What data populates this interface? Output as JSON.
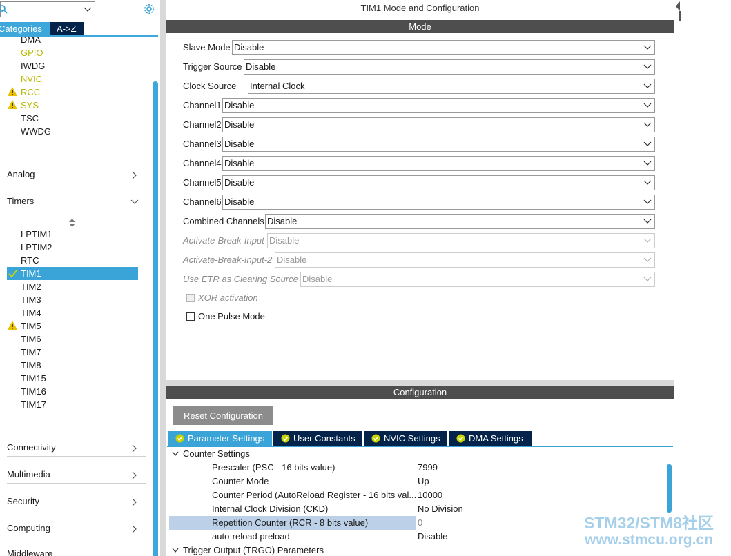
{
  "sidebar": {
    "search_value": "",
    "tabs": {
      "categories": "Categories",
      "az": "A->Z"
    },
    "system_items": [
      {
        "label": "DMA",
        "color": "normal",
        "warning": false
      },
      {
        "label": "GPIO",
        "color": "yellow",
        "warning": false
      },
      {
        "label": "IWDG",
        "color": "normal",
        "warning": false
      },
      {
        "label": "NVIC",
        "color": "yellow",
        "warning": false
      },
      {
        "label": "RCC",
        "color": "yellow",
        "warning": true
      },
      {
        "label": "SYS",
        "color": "yellow",
        "warning": true
      },
      {
        "label": "TSC",
        "color": "normal",
        "warning": false
      },
      {
        "label": "WWDG",
        "color": "normal",
        "warning": false
      }
    ],
    "categories": {
      "analog": "Analog",
      "timers": "Timers",
      "connectivity": "Connectivity",
      "multimedia": "Multimedia",
      "security": "Security",
      "computing": "Computing",
      "middleware": "Middleware"
    },
    "timer_items": [
      {
        "label": "LPTIM1",
        "state": "normal"
      },
      {
        "label": "LPTIM2",
        "state": "normal"
      },
      {
        "label": "RTC",
        "state": "normal"
      },
      {
        "label": "TIM1",
        "state": "selected"
      },
      {
        "label": "TIM2",
        "state": "normal"
      },
      {
        "label": "TIM3",
        "state": "normal"
      },
      {
        "label": "TIM4",
        "state": "normal"
      },
      {
        "label": "TIM5",
        "state": "warning"
      },
      {
        "label": "TIM6",
        "state": "normal"
      },
      {
        "label": "TIM7",
        "state": "normal"
      },
      {
        "label": "TIM8",
        "state": "normal"
      },
      {
        "label": "TIM15",
        "state": "normal"
      },
      {
        "label": "TIM16",
        "state": "normal"
      },
      {
        "label": "TIM17",
        "state": "normal"
      }
    ]
  },
  "mode": {
    "title": "TIM1 Mode and Configuration",
    "section_label": "Mode",
    "fields": {
      "slave_mode": {
        "label": "Slave Mode",
        "value": "Disable"
      },
      "trigger_source": {
        "label": "Trigger Source",
        "value": "Disable"
      },
      "clock_source": {
        "label": "Clock Source",
        "value": "Internal Clock"
      },
      "channel1": {
        "label": "Channel1",
        "value": "Disable"
      },
      "channel2": {
        "label": "Channel2",
        "value": "Disable"
      },
      "channel3": {
        "label": "Channel3",
        "value": "Disable"
      },
      "channel4": {
        "label": "Channel4",
        "value": "Disable"
      },
      "channel5": {
        "label": "Channel5",
        "value": "Disable"
      },
      "channel6": {
        "label": "Channel6",
        "value": "Disable"
      },
      "combined_channels": {
        "label": "Combined Channels",
        "value": "Disable"
      },
      "activate_break_input": {
        "label": "Activate-Break-Input",
        "value": "Disable"
      },
      "activate_break_input_2": {
        "label": "Activate-Break-Input-2",
        "value": "Disable"
      },
      "use_etr": {
        "label": "Use ETR as Clearing Source",
        "value": "Disable"
      }
    },
    "checkboxes": {
      "xor_activation": {
        "label": "XOR activation",
        "checked": false,
        "enabled": false
      },
      "one_pulse_mode": {
        "label": "One Pulse Mode",
        "checked": false,
        "enabled": true
      }
    }
  },
  "configuration": {
    "section_label": "Configuration",
    "reset_button": "Reset Configuration",
    "tabs": {
      "parameter_settings": "Parameter Settings",
      "user_constants": "User Constants",
      "nvic_settings": "NVIC Settings",
      "dma_settings": "DMA Settings"
    },
    "groups": {
      "counter_settings": "Counter Settings",
      "trigger_output": "Trigger Output (TRGO) Parameters"
    },
    "params": {
      "prescaler": {
        "name": "Prescaler (PSC - 16 bits value)",
        "value": "7999"
      },
      "counter_mode": {
        "name": "Counter Mode",
        "value": "Up"
      },
      "counter_period": {
        "name": "Counter Period (AutoReload Register - 16 bits val...",
        "value": "10000"
      },
      "ckd": {
        "name": "Internal Clock Division (CKD)",
        "value": "No Division"
      },
      "repetition_counter": {
        "name": "Repetition Counter (RCR - 8 bits value)",
        "value": "0"
      },
      "auto_reload": {
        "name": "auto-reload preload",
        "value": "Disable"
      }
    }
  },
  "watermark": {
    "line1": "STM32/STM8社区",
    "line2": "www.stmcu.org.cn"
  },
  "colors": {
    "accent_blue": "#3aa4d8",
    "navy": "#03234b",
    "section_bar": "#4e4e4e",
    "warning_yellow": "#e8c200",
    "check_green": "#c8d400"
  }
}
